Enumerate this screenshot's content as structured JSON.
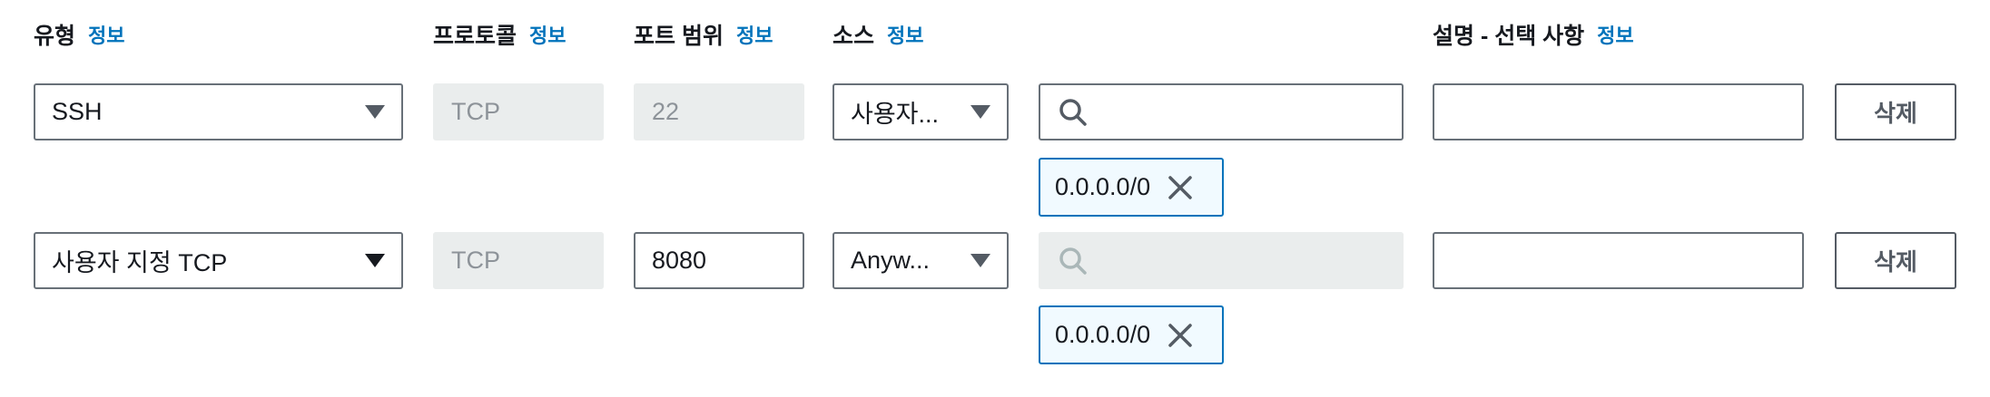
{
  "headers": {
    "type": "유형",
    "protocol": "프로토콜",
    "port_range": "포트 범위",
    "source": "소스",
    "description": "설명 - 선택 사항",
    "info": "정보"
  },
  "rules": [
    {
      "type": "SSH",
      "protocol": "TCP",
      "port_range": "22",
      "source_type": "사용자...",
      "search_placeholder": "",
      "cidr_token": "0.0.0.0/0",
      "description": "",
      "delete_label": "삭제"
    },
    {
      "type": "사용자 지정 TCP",
      "protocol": "TCP",
      "port_range": "8080",
      "source_type": "Anyw...",
      "search_placeholder": "",
      "cidr_token": "0.0.0.0/0",
      "description": "",
      "delete_label": "삭제"
    }
  ],
  "icons": {
    "caret": "caret-down-icon",
    "search": "search-icon",
    "remove": "close-icon"
  },
  "colors": {
    "link": "#0073bb",
    "token_border": "#0073bb",
    "token_bg": "#f1faff",
    "disabled_bg": "#eaeded",
    "border": "#687078"
  }
}
